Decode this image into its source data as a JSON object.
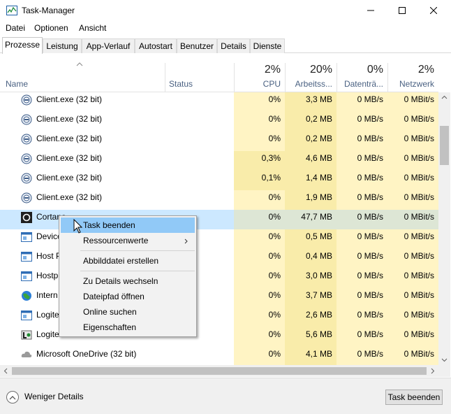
{
  "window": {
    "title": "Task-Manager"
  },
  "menu": [
    "Datei",
    "Optionen",
    "Ansicht"
  ],
  "tabs": [
    "Prozesse",
    "Leistung",
    "App-Verlauf",
    "Autostart",
    "Benutzer",
    "Details",
    "Dienste"
  ],
  "active_tab": "Prozesse",
  "columns": {
    "name": "Name",
    "status": "Status",
    "cpu": {
      "percent": "2%",
      "label": "CPU"
    },
    "memory": {
      "percent": "20%",
      "label": "Arbeitss..."
    },
    "disk": {
      "percent": "0%",
      "label": "Datenträ..."
    },
    "network": {
      "percent": "2%",
      "label": "Netzwerk"
    }
  },
  "processes": [
    {
      "name": "Client.exe (32 bit)",
      "icon": "client-icon",
      "cpu": "0%",
      "memory": "3,3 MB",
      "disk": "0 MB/s",
      "network": "0 MBit/s"
    },
    {
      "name": "Client.exe (32 bit)",
      "icon": "client-icon",
      "cpu": "0%",
      "memory": "0,2 MB",
      "disk": "0 MB/s",
      "network": "0 MBit/s"
    },
    {
      "name": "Client.exe (32 bit)",
      "icon": "client-icon",
      "cpu": "0%",
      "memory": "0,2 MB",
      "disk": "0 MB/s",
      "network": "0 MBit/s"
    },
    {
      "name": "Client.exe (32 bit)",
      "icon": "client-icon",
      "cpu": "0,3%",
      "memory": "4,6 MB",
      "disk": "0 MB/s",
      "network": "0 MBit/s"
    },
    {
      "name": "Client.exe (32 bit)",
      "icon": "client-icon",
      "cpu": "0,1%",
      "memory": "1,4 MB",
      "disk": "0 MB/s",
      "network": "0 MBit/s"
    },
    {
      "name": "Client.exe (32 bit)",
      "icon": "client-icon",
      "cpu": "0%",
      "memory": "1,9 MB",
      "disk": "0 MB/s",
      "network": "0 MBit/s"
    },
    {
      "name": "Cortana",
      "icon": "cortana-icon",
      "cpu": "0%",
      "memory": "47,7 MB",
      "disk": "0 MB/s",
      "network": "0 MBit/s",
      "selected": true
    },
    {
      "name": "Device",
      "icon": "window-icon",
      "cpu": "0%",
      "memory": "0,5 MB",
      "disk": "0 MB/s",
      "network": "0 MBit/s"
    },
    {
      "name": "Host P",
      "icon": "window-icon",
      "cpu": "0%",
      "memory": "0,4 MB",
      "disk": "0 MB/s",
      "network": "0 MBit/s"
    },
    {
      "name": "Hostp",
      "icon": "window-icon",
      "cpu": "0%",
      "memory": "3,0 MB",
      "disk": "0 MB/s",
      "network": "0 MBit/s"
    },
    {
      "name": "Intern",
      "icon": "globe-icon",
      "cpu": "0%",
      "memory": "3,7 MB",
      "disk": "0 MB/s",
      "network": "0 MBit/s"
    },
    {
      "name": "Logite",
      "icon": "window-icon",
      "cpu": "0%",
      "memory": "2,6 MB",
      "disk": "0 MB/s",
      "network": "0 MBit/s"
    },
    {
      "name": "Logite",
      "icon": "logitech-icon",
      "cpu": "0%",
      "memory": "5,6 MB",
      "disk": "0 MB/s",
      "network": "0 MBit/s"
    },
    {
      "name": "Microsoft OneDrive (32 bit)",
      "icon": "cloud-icon",
      "cpu": "0%",
      "memory": "4,1 MB",
      "disk": "0 MB/s",
      "network": "0 MBit/s"
    }
  ],
  "context_menu": {
    "end_task": "Task beenden",
    "resource_values": "Ressourcenwerte",
    "create_dump": "Abbilddatei erstellen",
    "go_to_details": "Zu Details wechseln",
    "open_file_location": "Dateipfad öffnen",
    "search_online": "Online suchen",
    "properties": "Eigenschaften"
  },
  "footer": {
    "fewer_details": "Weniger Details",
    "end_task_button": "Task beenden"
  },
  "colors": {
    "selection": "#cce8ff",
    "heat_low": "#fff4c4",
    "heat_mid": "#f9ecaa",
    "menu_highlight": "#91c9f7",
    "header_label": "#4a6182"
  }
}
